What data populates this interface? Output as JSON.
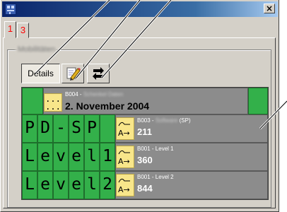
{
  "window": {
    "close_glyph": "×",
    "icon": "app-icon"
  },
  "tabs": [
    {
      "label": "1",
      "active": true
    },
    {
      "label": "3",
      "active": false
    }
  ],
  "group": {
    "label": "Mobilitäten"
  },
  "toolbar": {
    "details_label": "Details",
    "edit_icon": "edit-pencil-icon",
    "switch_icon": "switch-arrows-icon"
  },
  "rows": [
    {
      "letters": [],
      "code": "B004 -",
      "code_blurred": "Schenkel Daten",
      "value": "2. November 2004",
      "icon": "dots-icon"
    },
    {
      "letters": [
        "P",
        "D",
        "-",
        "S",
        "P",
        ""
      ],
      "code": "B003 -",
      "code_blurred": "Software",
      "code_suffix": "(SP)",
      "value": "211",
      "icon": "wave-arrow-icon"
    },
    {
      "letters": [
        "L",
        "e",
        "v",
        "e",
        "l",
        "1"
      ],
      "code": "B001 - Level 1",
      "value": "360",
      "icon": "wave-arrow-icon"
    },
    {
      "letters": [
        "L",
        "e",
        "v",
        "e",
        "l",
        "2"
      ],
      "code": "B001 - Level 2",
      "value": "844",
      "icon": "wave-arrow-icon"
    }
  ],
  "icon_glyphs": {
    "dots": "... ...",
    "wave_arrow": "A→"
  },
  "colors": {
    "title_start": "#0a246a",
    "title_end": "#a6caf0",
    "cell_green": "#33b04a",
    "cell_gray": "#8c8c8c",
    "icon_yellow": "#f8e68a",
    "tab_red": "#ff0000"
  }
}
